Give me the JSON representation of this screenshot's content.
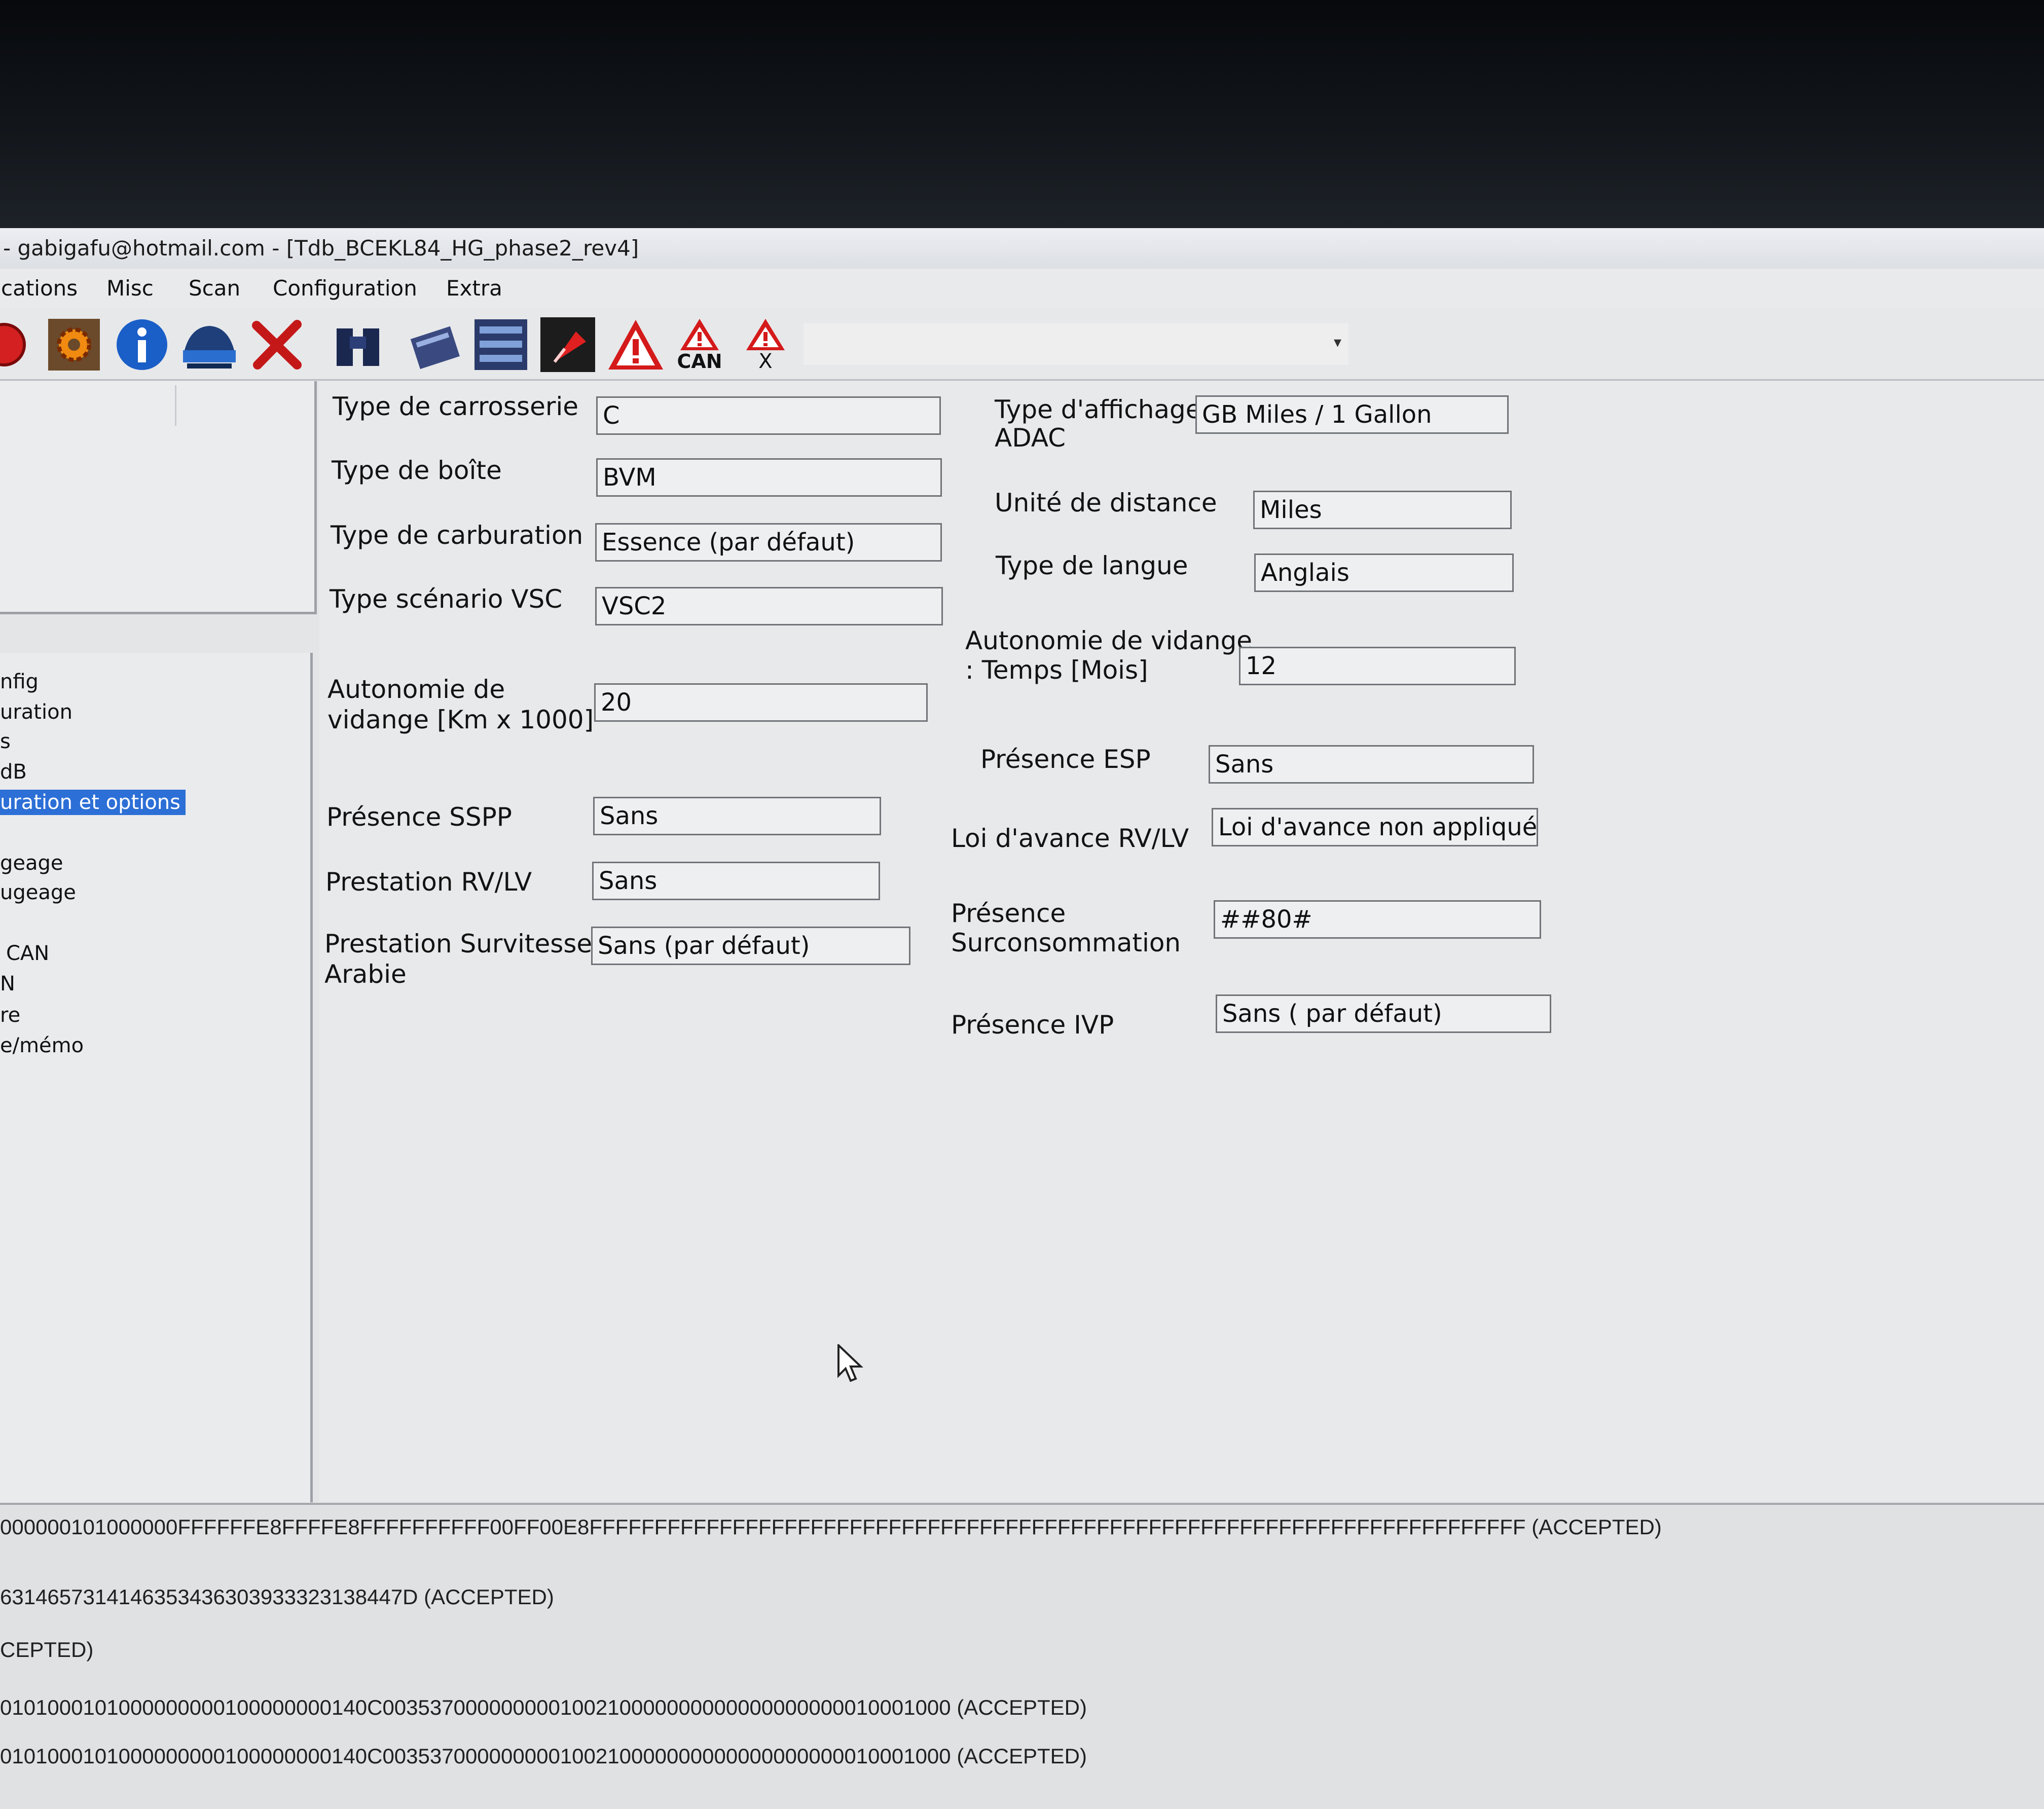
{
  "window": {
    "title": "- gabigafu@hotmail.com -  [Tdb_BCEKL84_HG_phase2_rev4]"
  },
  "menu": [
    "cations",
    "Misc",
    "Scan",
    "Configuration",
    "Extra"
  ],
  "toolbar": {
    "icons": [
      "stop-icon",
      "settings-gear-icon",
      "info-icon",
      "vehicle-scan-icon",
      "cancel-x-icon",
      "binoculars-icon",
      "ecu-programming-icon",
      "module-config-icon",
      "flag-icon",
      "warning-icon",
      "can-warning-icon",
      "warning-clear-icon"
    ],
    "can_label": "CAN",
    "x_label": "X",
    "combo_value": ""
  },
  "tree": {
    "items": [
      "nfig",
      "uration",
      "s",
      "dB",
      "uration et options",
      "geage",
      "ugeage",
      "CAN",
      "N",
      "re",
      "e/mémo"
    ],
    "selected_index": 4
  },
  "form": {
    "left": [
      {
        "label": "Type de carrosserie",
        "value": "C"
      },
      {
        "label": "Type de boîte",
        "value": "BVM"
      },
      {
        "label": "Type de carburation",
        "value": "Essence (par défaut)"
      },
      {
        "label": "Type scénario VSC",
        "value": "VSC2"
      },
      {
        "label_line1": "Autonomie de",
        "label_line2": "vidange [Km x 1000]",
        "value": "20"
      },
      {
        "label": "Présence SSPP",
        "value": "Sans"
      },
      {
        "label": "Prestation RV/LV",
        "value": "Sans"
      },
      {
        "label_line1": "Prestation Survitesse",
        "label_line2": "Arabie",
        "value": "Sans (par défaut)"
      }
    ],
    "right": [
      {
        "label_line1": "Type d'affichage",
        "label_line2": "ADAC",
        "value": "GB Miles / 1 Gallon"
      },
      {
        "label": "Unité de distance",
        "value": "Miles"
      },
      {
        "label": "Type de langue",
        "value": "Anglais"
      },
      {
        "label_line1": "Autonomie de vidange",
        "label_line2": ": Temps [Mois]",
        "value": "12"
      },
      {
        "label": "Présence ESP",
        "value": "Sans"
      },
      {
        "label": "Loi d'avance RV/LV",
        "value": "Loi d'avance non appliquée(pa"
      },
      {
        "label_line1": "Présence",
        "label_line2": "Surconsommation",
        "value": "##80#"
      },
      {
        "label": "Présence IVP",
        "value": "Sans ( par défaut)"
      }
    ]
  },
  "log": [
    "000000101000000FFFFFFE8FFFFE8FFFFFFFFFF00FF00E8FFFFFFFFFFFFFFFFFFFFFFFFFFFFFFFFFFFFFFFFFFFFFFFFFFFFFFFFFFFFFFFFFFFFFFFF (ACCEPTED)",
    "6314657314146353436303933323138447D (ACCEPTED)",
    "CEPTED)",
    "0101000101000000000100000000140C003537000000000100210000000000000000000010001000 (ACCEPTED)",
    "0101000101000000000100000000140C003537000000000100210000000000000000000010001000 (ACCEPTED)"
  ]
}
